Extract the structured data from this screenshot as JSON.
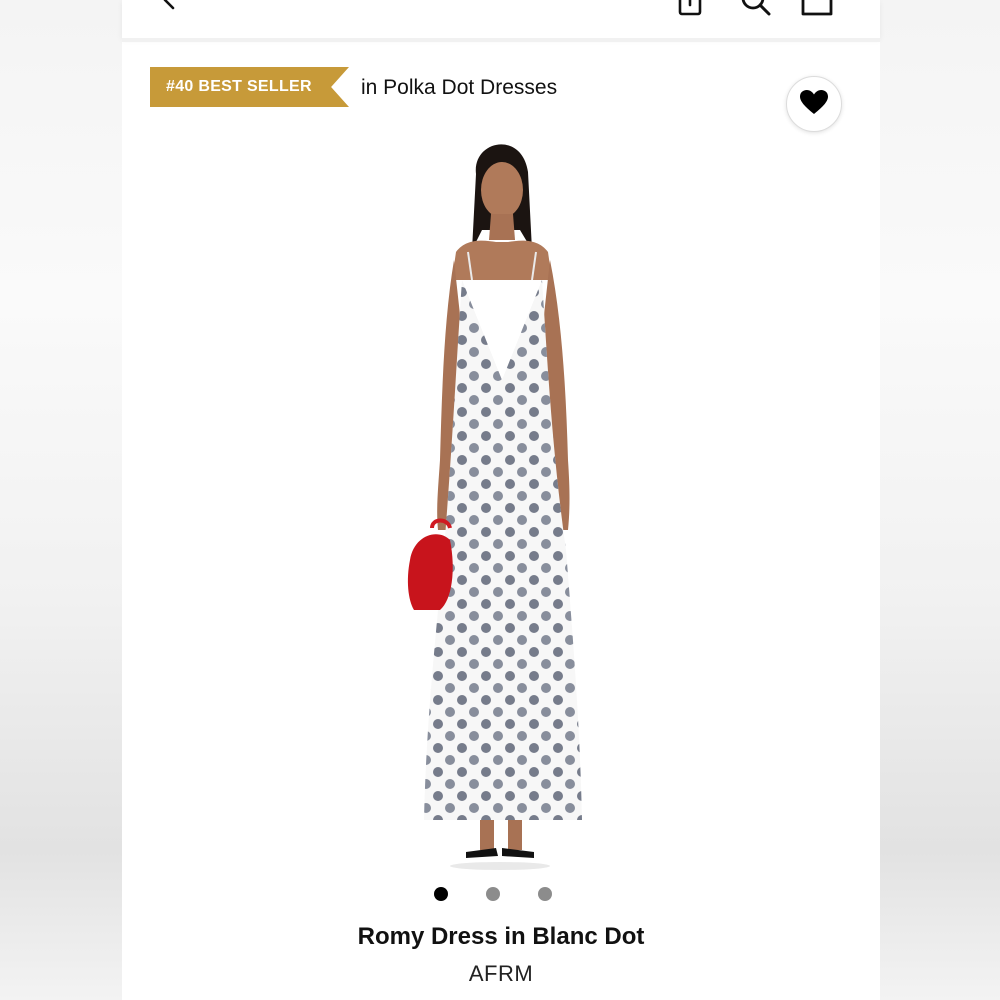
{
  "icons": {
    "back": "chevron-left-icon",
    "share": "share-icon",
    "search": "search-icon",
    "bag": "shopping-bag-icon",
    "favorite": "heart-icon"
  },
  "badge": {
    "label": "#40 BEST SELLER",
    "category": "in Polka Dot Dresses",
    "color": "#c79a39"
  },
  "gallery": {
    "count": 3,
    "active_index": 0
  },
  "product": {
    "title": "Romy Dress in Blanc Dot",
    "brand": "AFRM"
  }
}
